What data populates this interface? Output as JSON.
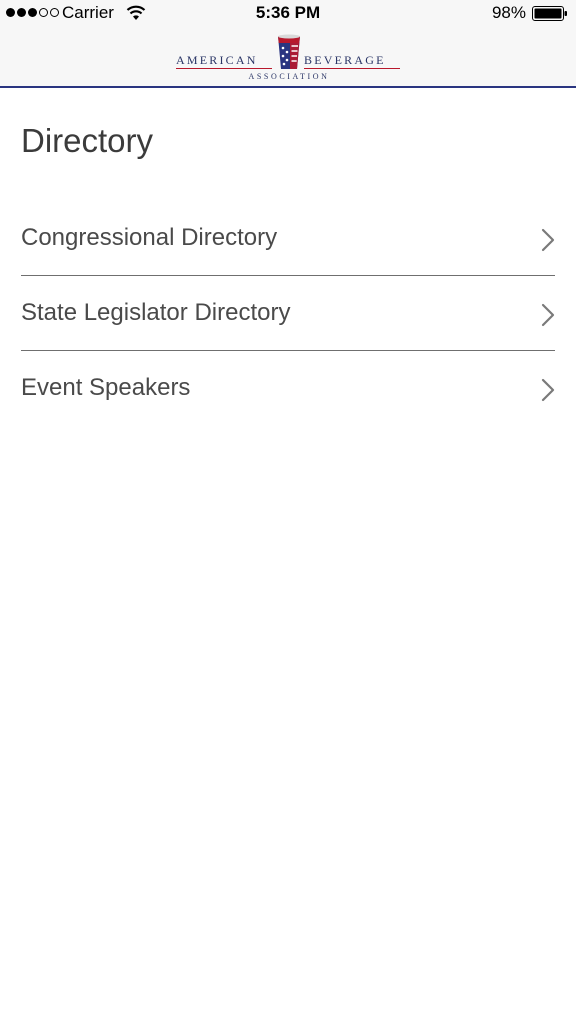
{
  "status_bar": {
    "carrier": "Carrier",
    "time": "5:36 PM",
    "battery": "98%"
  },
  "header": {
    "logo_left": "AMERICAN",
    "logo_right": "BEVERAGE",
    "logo_sub": "ASSOCIATION",
    "brand_colors": {
      "navy": "#2a3580",
      "red": "#b8182c"
    }
  },
  "page": {
    "title": "Directory"
  },
  "directory": {
    "items": [
      {
        "label": "Congressional Directory",
        "icon": "chevron-right-icon"
      },
      {
        "label": "State Legislator Directory",
        "icon": "chevron-right-icon"
      },
      {
        "label": "Event Speakers",
        "icon": "chevron-right-icon"
      }
    ]
  }
}
